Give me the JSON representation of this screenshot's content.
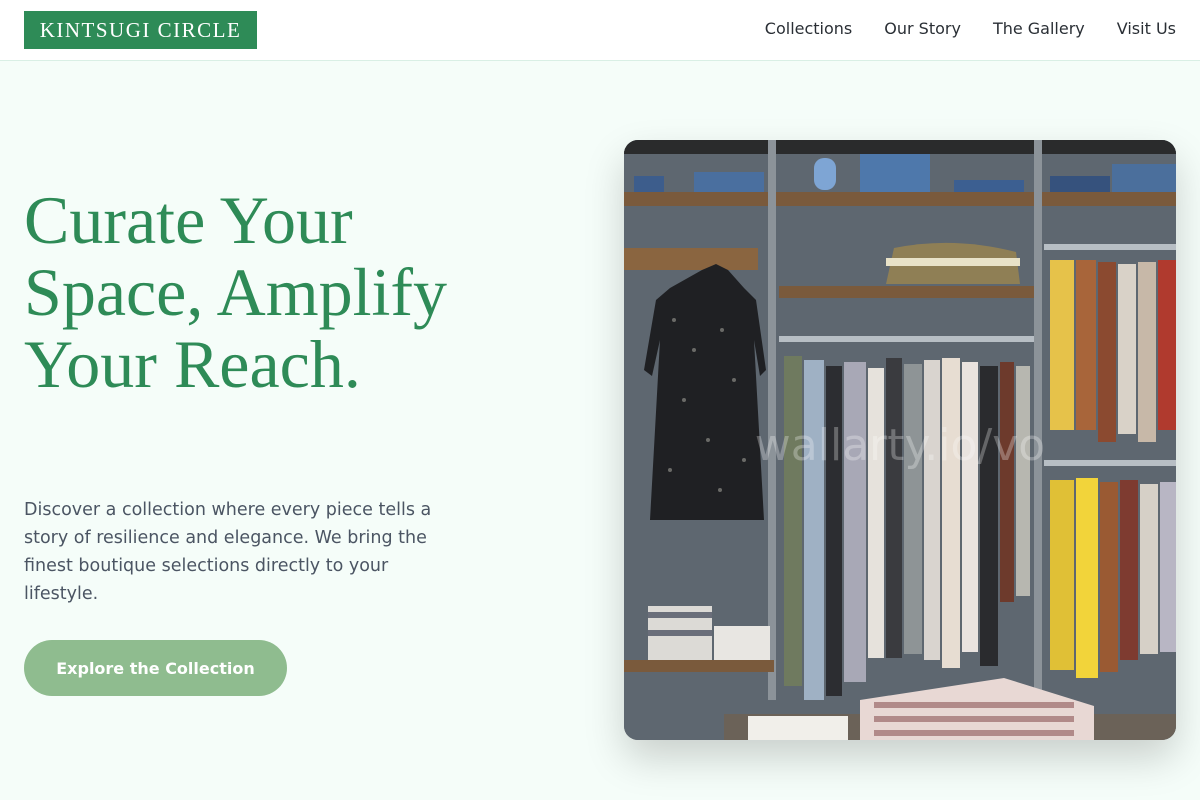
{
  "header": {
    "logo_text": "KINTSUGI CIRCLE",
    "nav": [
      {
        "label": "Collections"
      },
      {
        "label": "Our Story"
      },
      {
        "label": "The Gallery"
      },
      {
        "label": "Visit Us"
      }
    ]
  },
  "hero": {
    "title": "Curate Your Space, Amplify Your Reach.",
    "subtitle": "Discover a collection where every piece tells a story of resilience and elegance. We bring the finest boutique selections directly to your lifestyle.",
    "cta_label": "Explore the Collection",
    "image": {
      "watermark": "wallarty.io/vo"
    }
  },
  "colors": {
    "brand": "#2e8b57",
    "cta": "#8fbc8f",
    "background": "#f5fdf9",
    "text_muted": "#4b5563"
  }
}
